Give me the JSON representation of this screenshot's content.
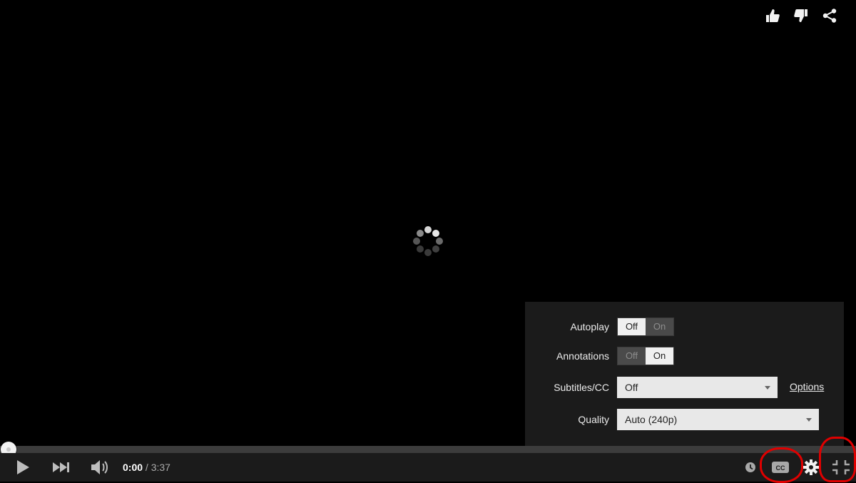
{
  "player": {
    "time": {
      "current": "0:00",
      "separator": "/",
      "duration": "3:37"
    },
    "progress": {
      "played_fraction": 0.0
    },
    "state": "loading"
  },
  "top_actions": [
    {
      "icon": "thumbs-up-icon"
    },
    {
      "icon": "thumbs-down-icon"
    },
    {
      "icon": "share-icon"
    }
  ],
  "settings": {
    "autoplay": {
      "label": "Autoplay",
      "off": "Off",
      "on": "On",
      "selected": "Off"
    },
    "annotations": {
      "label": "Annotations",
      "off": "Off",
      "on": "On",
      "selected": "On"
    },
    "subtitles": {
      "label": "Subtitles/CC",
      "value": "Off",
      "options_link": "Options"
    },
    "quality": {
      "label": "Quality",
      "value": "Auto (240p)"
    }
  },
  "controls": {
    "left": [
      "play-icon",
      "next-icon",
      "volume-icon"
    ],
    "right": [
      "watch-later-icon",
      "captions-icon",
      "settings-icon",
      "exit-fullscreen-icon"
    ]
  },
  "colors": {
    "background": "#000000",
    "panel": "#1b1b1b",
    "progress_played": "#b31217",
    "highlight_annotation": "#e00000"
  }
}
